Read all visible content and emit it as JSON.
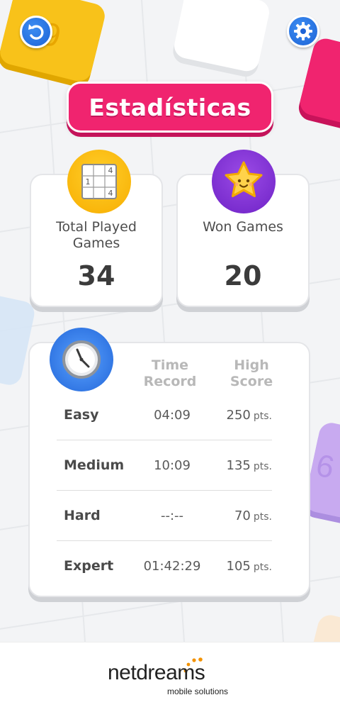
{
  "header": {
    "title": "Estadísticas",
    "back_icon": "back-arrow-icon",
    "settings_icon": "gear-icon"
  },
  "stats": {
    "played": {
      "label": "Total Played Games",
      "value": "34",
      "icon": "sudoku-grid-icon",
      "grid_digits": [
        "4",
        "1",
        "4"
      ]
    },
    "won": {
      "label": "Won Games",
      "value": "20",
      "icon": "star-face-icon"
    }
  },
  "records": {
    "icon": "clock-icon",
    "headers": {
      "time": "Time Record",
      "score": "High Score"
    },
    "pts_label": "pts.",
    "rows": [
      {
        "level": "Easy",
        "time": "04:09",
        "score": "250"
      },
      {
        "level": "Medium",
        "time": "10:09",
        "score": "135"
      },
      {
        "level": "Hard",
        "time": "--:--",
        "score": "70"
      },
      {
        "level": "Expert",
        "time": "01:42:29",
        "score": "105"
      }
    ]
  },
  "background": {
    "tile_digit_yellow": "9",
    "tile_digit_purple": "6"
  },
  "footer": {
    "logo_name": "netdreams",
    "logo_tagline": "mobile solutions"
  },
  "colors": {
    "accent_pink": "#f0246f",
    "badge_yellow": "#f7ad00",
    "badge_purple": "#7a2bd0",
    "button_blue": "#1d63d6",
    "logo_orange": "#f39200"
  }
}
